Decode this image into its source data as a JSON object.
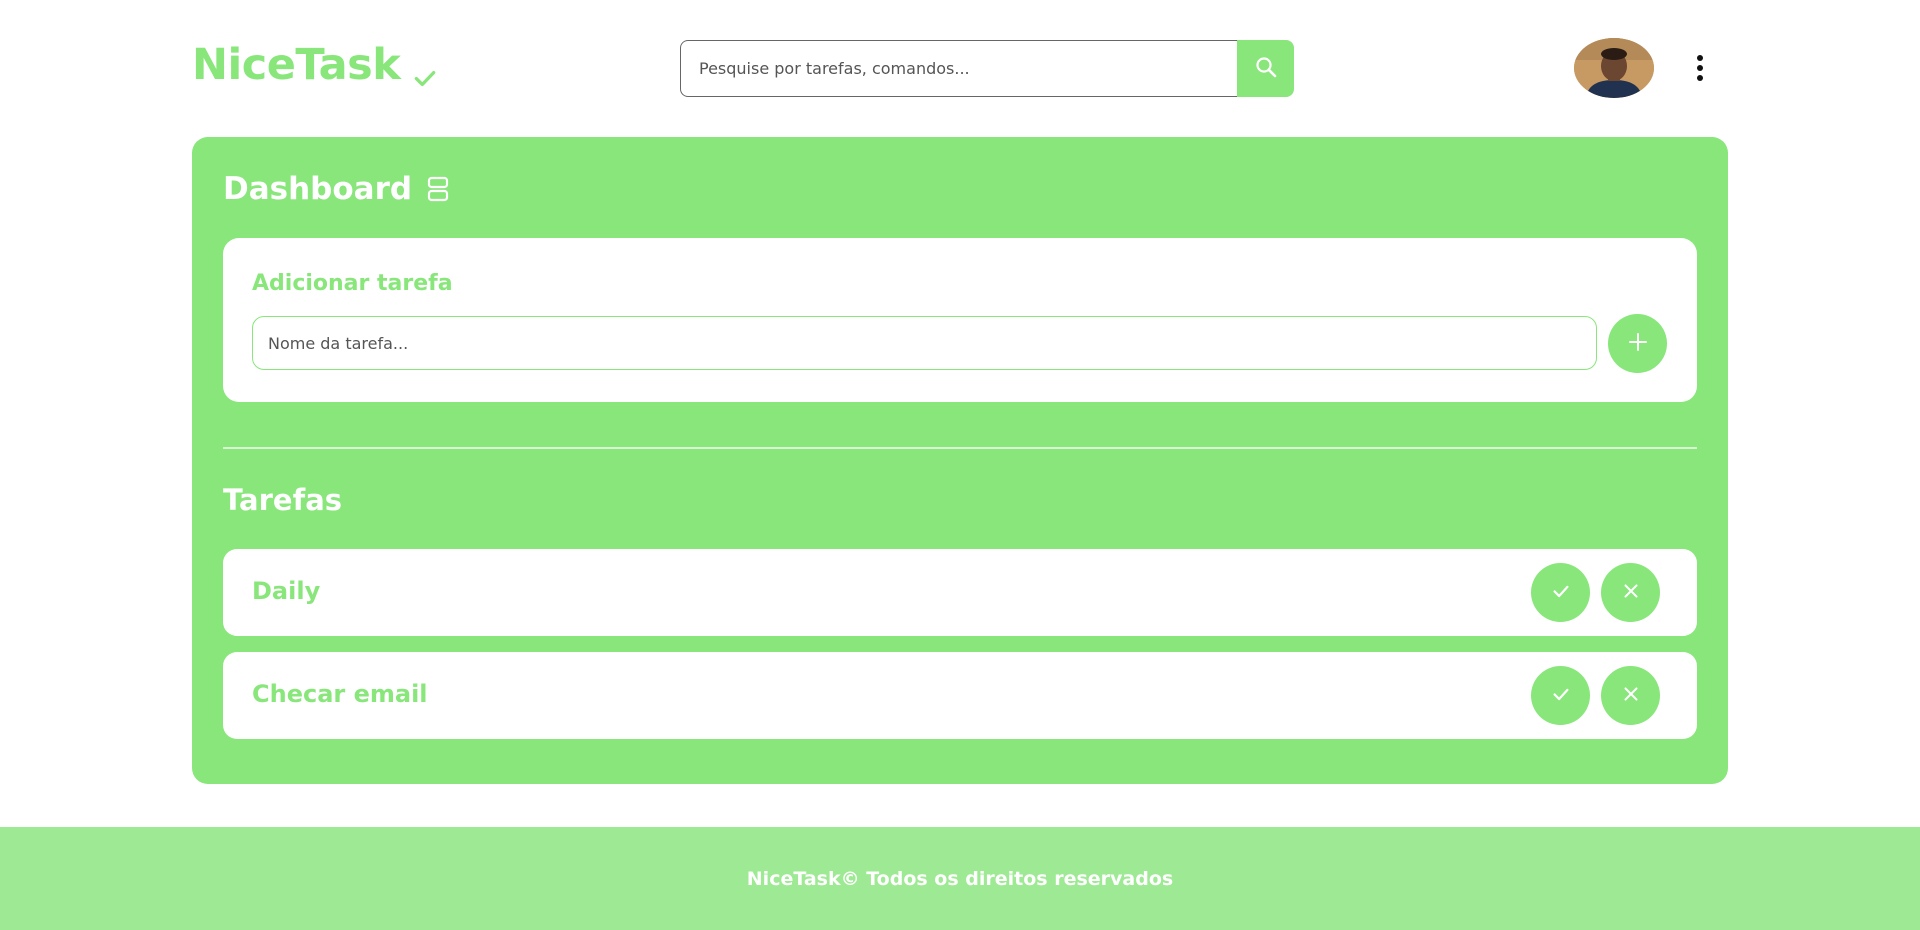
{
  "header": {
    "brand": "NiceTask",
    "brand_icon": "check-icon",
    "search_placeholder": "Pesquise por tarefas, comandos...",
    "search_icon": "search-icon",
    "menu_icon": "kebab-menu-icon"
  },
  "dashboard": {
    "title": "Dashboard",
    "title_icon": "layout-rows-icon",
    "add_task": {
      "title": "Adicionar tarefa",
      "input_placeholder": "Nome da tarefa...",
      "add_icon": "plus-icon"
    },
    "tasks_title": "Tarefas",
    "tasks": [
      {
        "name": "Daily"
      },
      {
        "name": "Checar email"
      }
    ]
  },
  "footer": {
    "text": "NiceTask© Todos os direitos reservados"
  },
  "colors": {
    "accent": "#88e67b",
    "footer": "#9ee993",
    "white": "#ffffff"
  }
}
